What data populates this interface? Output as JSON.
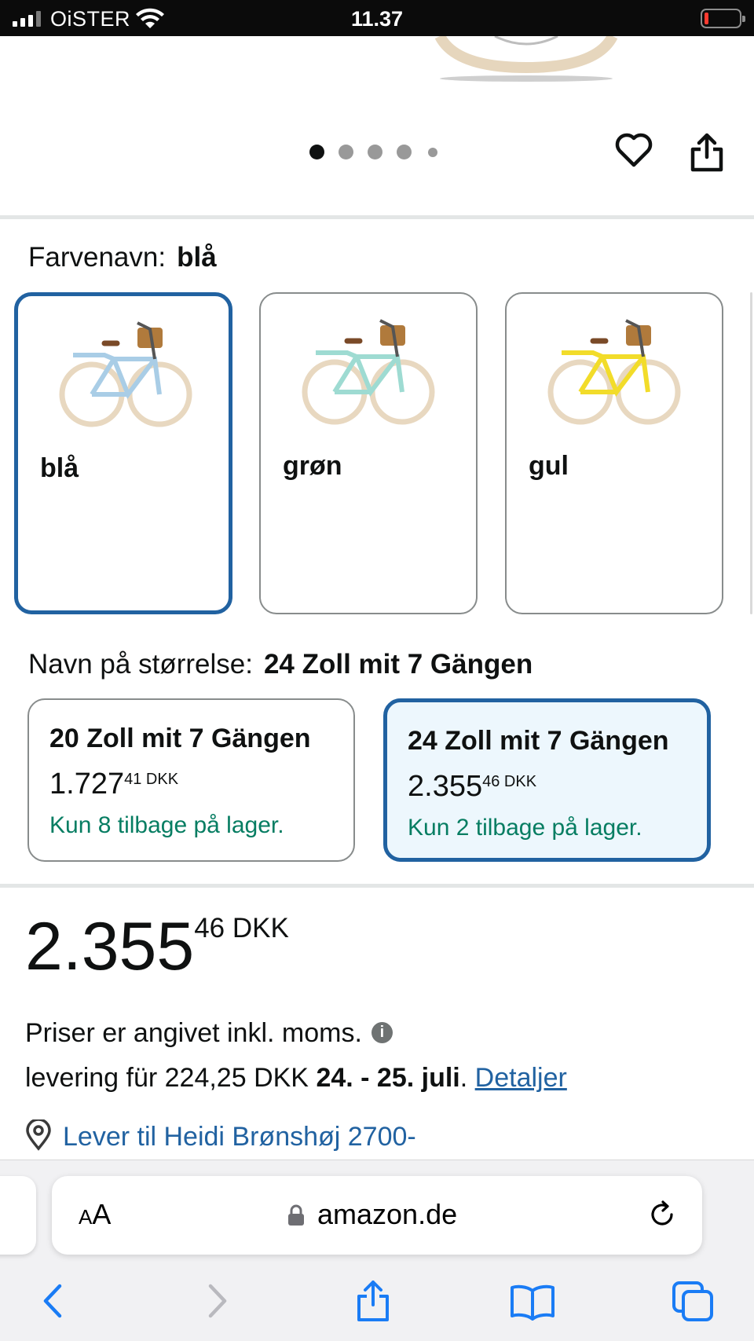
{
  "status_bar": {
    "carrier": "OiSTER",
    "time": "11.37"
  },
  "carousel": {
    "dot_count": 5,
    "active_index": 0
  },
  "colors": {
    "label": "Farvenavn:",
    "selected": "blå",
    "options": [
      {
        "name": "blå",
        "bike_color": "#a9cde6",
        "selected": true
      },
      {
        "name": "grøn",
        "bike_color": "#9edbd2",
        "selected": false
      },
      {
        "name": "gul",
        "bike_color": "#f2dc2a",
        "selected": false
      }
    ]
  },
  "sizes": {
    "label": "Navn på størrelse:",
    "selected": "24 Zoll mit 7 Gängen",
    "options": [
      {
        "title": "20 Zoll mit 7 Gängen",
        "price_main": "1.727",
        "price_fraction": "41",
        "currency": "DKK",
        "stock": "Kun 8 tilbage på lager.",
        "selected": false
      },
      {
        "title": "24 Zoll mit 7 Gängen",
        "price_main": "2.355",
        "price_fraction": "46",
        "currency": "DKK",
        "stock": "Kun 2 tilbage på lager.",
        "selected": true
      }
    ]
  },
  "price": {
    "main": "2.355",
    "fraction": "46",
    "currency": "DKK",
    "vat_note": "Priser er angivet inkl. moms.",
    "delivery_prefix": "levering für 224,25 DKK ",
    "delivery_date": "24. - 25. juli",
    "delivery_suffix": ". ",
    "details_link": "Detaljer",
    "deliver_to": "Lever til Heidi Brønshøj 2700‌-"
  },
  "browser": {
    "text_size_label_small": "A",
    "text_size_label_big": "A",
    "url": "amazon.de"
  },
  "theme": {
    "accent": "#2162a1",
    "stock_green": "#067d62",
    "selected_bg": "#edf7fd",
    "ios_blue": "#1a7cf5"
  }
}
